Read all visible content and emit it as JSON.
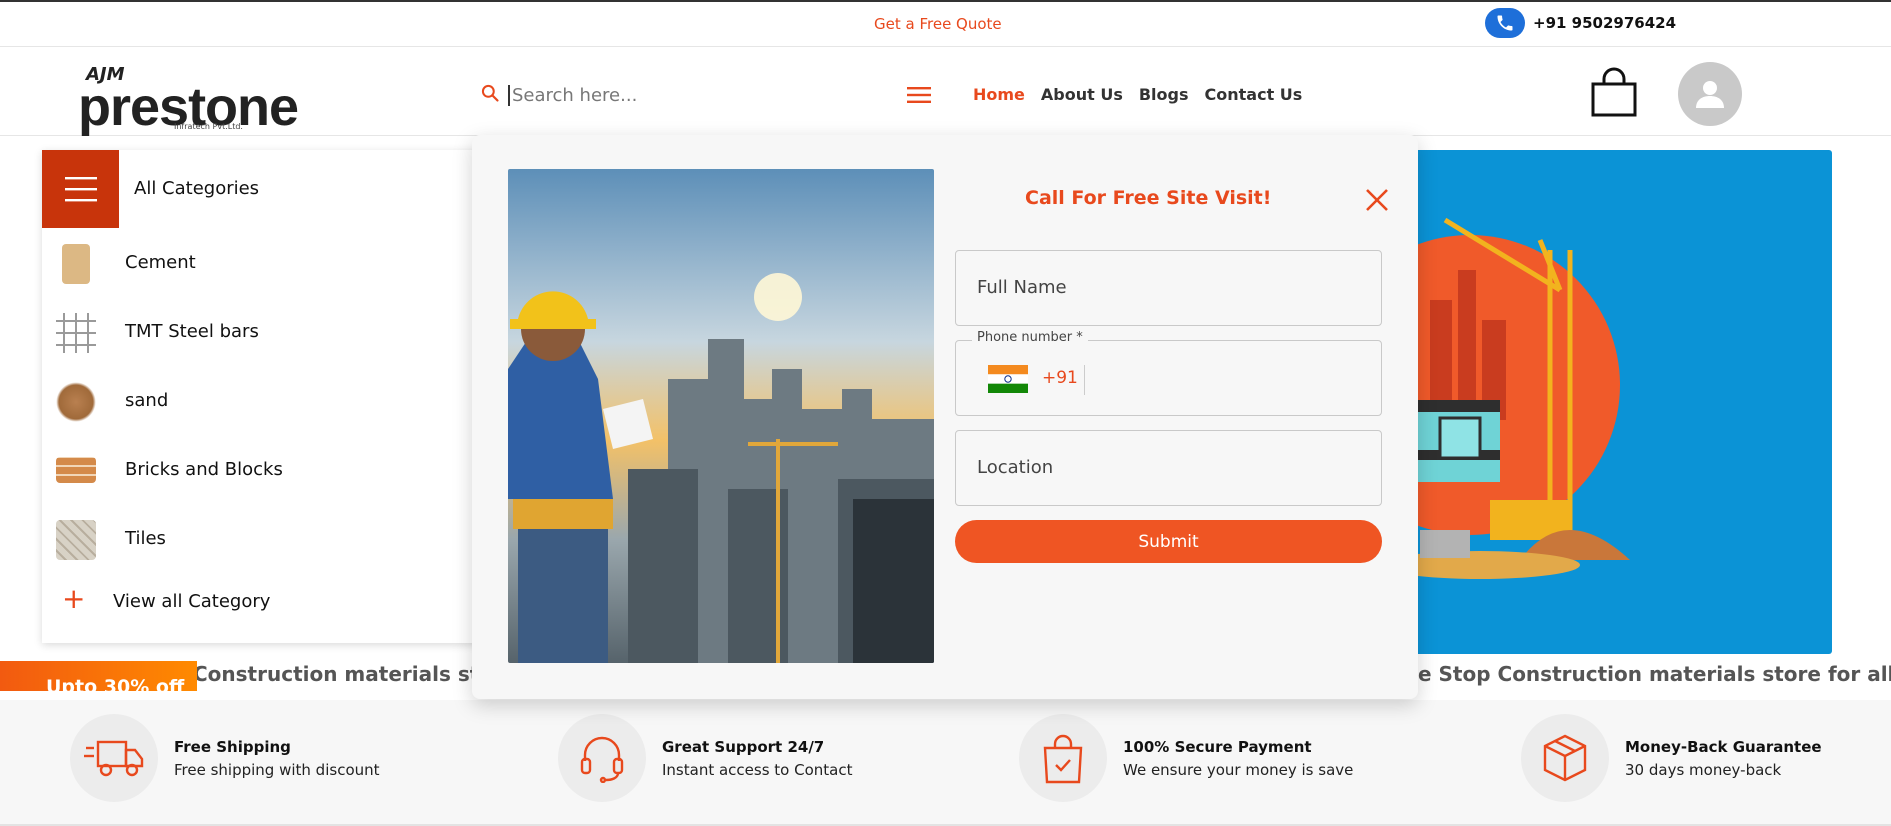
{
  "topbar": {
    "quote_label": "Get a Free Quote",
    "phone": "+91 9502976424",
    "phone_icon": "phone-icon"
  },
  "header": {
    "logo": {
      "brand_top": "AJM",
      "brand": "prestone",
      "tagline": "Infratech Pvt.Ltd."
    },
    "search": {
      "placeholder": "Search here...",
      "icon": "search-icon"
    },
    "nav": [
      "Home",
      "About Us",
      "Blogs",
      "Contact Us"
    ],
    "active_nav": "Home",
    "cart_icon": "shopping-bag-icon",
    "profile_icon": "user-avatar-icon"
  },
  "categories": {
    "title": "All Categories",
    "items": [
      {
        "label": "Cement",
        "color": "#d8b483"
      },
      {
        "label": "TMT Steel bars",
        "color": "#9a9a9a"
      },
      {
        "label": "sand",
        "color": "#b07a45"
      },
      {
        "label": "Bricks and Blocks",
        "color": "#d48a4a"
      },
      {
        "label": "Tiles",
        "color": "#c9c3b6"
      }
    ],
    "view_all": "View all Category"
  },
  "marquee": {
    "left_text": "Construction materials store",
    "right_text": "e Stop Construction materials store for all type of"
  },
  "offer": {
    "text": "Upto 30% off"
  },
  "features": [
    {
      "title": "Free Shipping",
      "desc": "Free shipping with discount",
      "icon": "truck-icon"
    },
    {
      "title": "Great Support 24/7",
      "desc": "Instant access to Contact",
      "icon": "headset-icon"
    },
    {
      "title": "100% Secure Payment",
      "desc": "We ensure your money is save",
      "icon": "secure-bag-icon"
    },
    {
      "title": "Money-Back Guarantee",
      "desc": "30 days money-back",
      "icon": "box-icon"
    }
  ],
  "modal": {
    "title": "Call For Free Site Visit!",
    "full_name_placeholder": "Full Name",
    "phone_label": "Phone number *",
    "country_code": "+91",
    "location_placeholder": "Location",
    "submit_label": "Submit"
  },
  "colors": {
    "accent": "#e8491d",
    "hero_bg": "#0b93d6",
    "category_button": "#c8340b"
  }
}
